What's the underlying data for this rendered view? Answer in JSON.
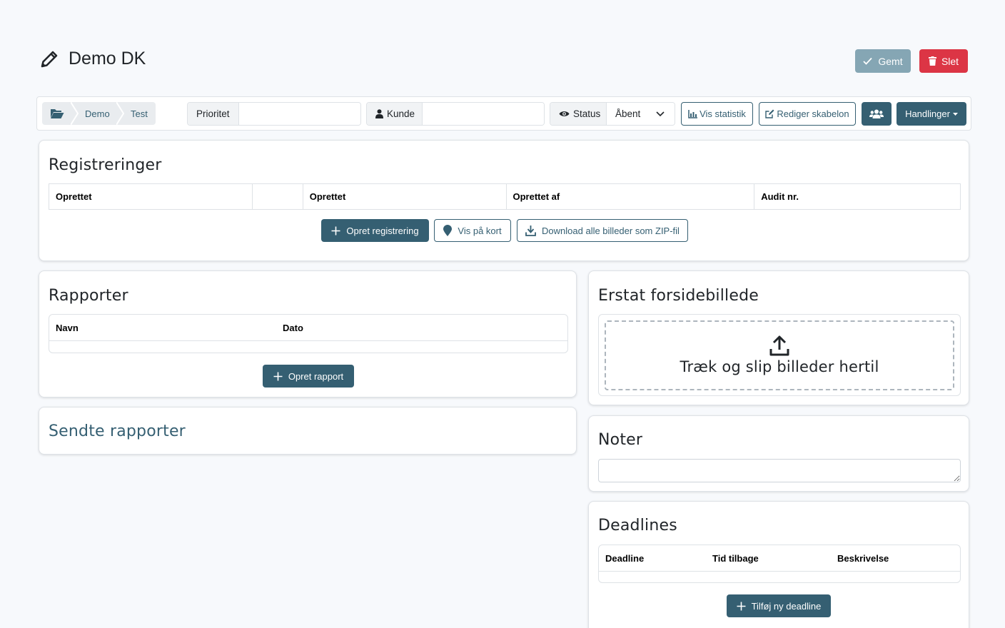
{
  "header": {
    "title": "Demo DK",
    "saved_label": "Gemt",
    "delete_label": "Slet"
  },
  "toolbar": {
    "breadcrumb": [
      "Demo",
      "Test"
    ],
    "priority_label": "Prioritet",
    "priority_value": "",
    "customer_label": "Kunde",
    "customer_value": "",
    "status_label": "Status",
    "status_value": "Åbent",
    "stats_label": "Vis statistik",
    "edit_template_label": "Rediger skabelon",
    "actions_label": "Handlinger"
  },
  "registrations": {
    "title": "Registreringer",
    "columns": [
      "Oprettet",
      "",
      "Oprettet",
      "Oprettet af",
      "Audit nr."
    ],
    "create_label": "Opret registrering",
    "map_label": "Vis på kort",
    "download_label": "Download alle billeder som ZIP-fil"
  },
  "reports": {
    "title": "Rapporter",
    "columns": [
      "Navn",
      "Dato"
    ],
    "create_label": "Opret rapport"
  },
  "sent_reports": {
    "title": "Sendte rapporter"
  },
  "cover_image": {
    "title": "Erstat forsidebillede",
    "drop_text": "Træk og slip billeder hertil"
  },
  "notes": {
    "title": "Noter",
    "value": ""
  },
  "deadlines": {
    "title": "Deadlines",
    "columns": [
      "Deadline",
      "Tid tilbage",
      "Beskrivelse"
    ],
    "add_label": "Tilføj ny deadline"
  },
  "colors": {
    "primary": "#355f72",
    "danger": "#dc3545",
    "saved": "#85a6b4",
    "background": "#f7f9fc"
  },
  "icons": [
    "pencil-icon",
    "check-icon",
    "trash-icon",
    "folder-open-icon",
    "user-icon",
    "eye-icon",
    "chevron-down-icon",
    "chart-icon",
    "edit-icon",
    "users-icon",
    "plus-icon",
    "map-marker-icon",
    "download-icon",
    "upload-icon"
  ]
}
